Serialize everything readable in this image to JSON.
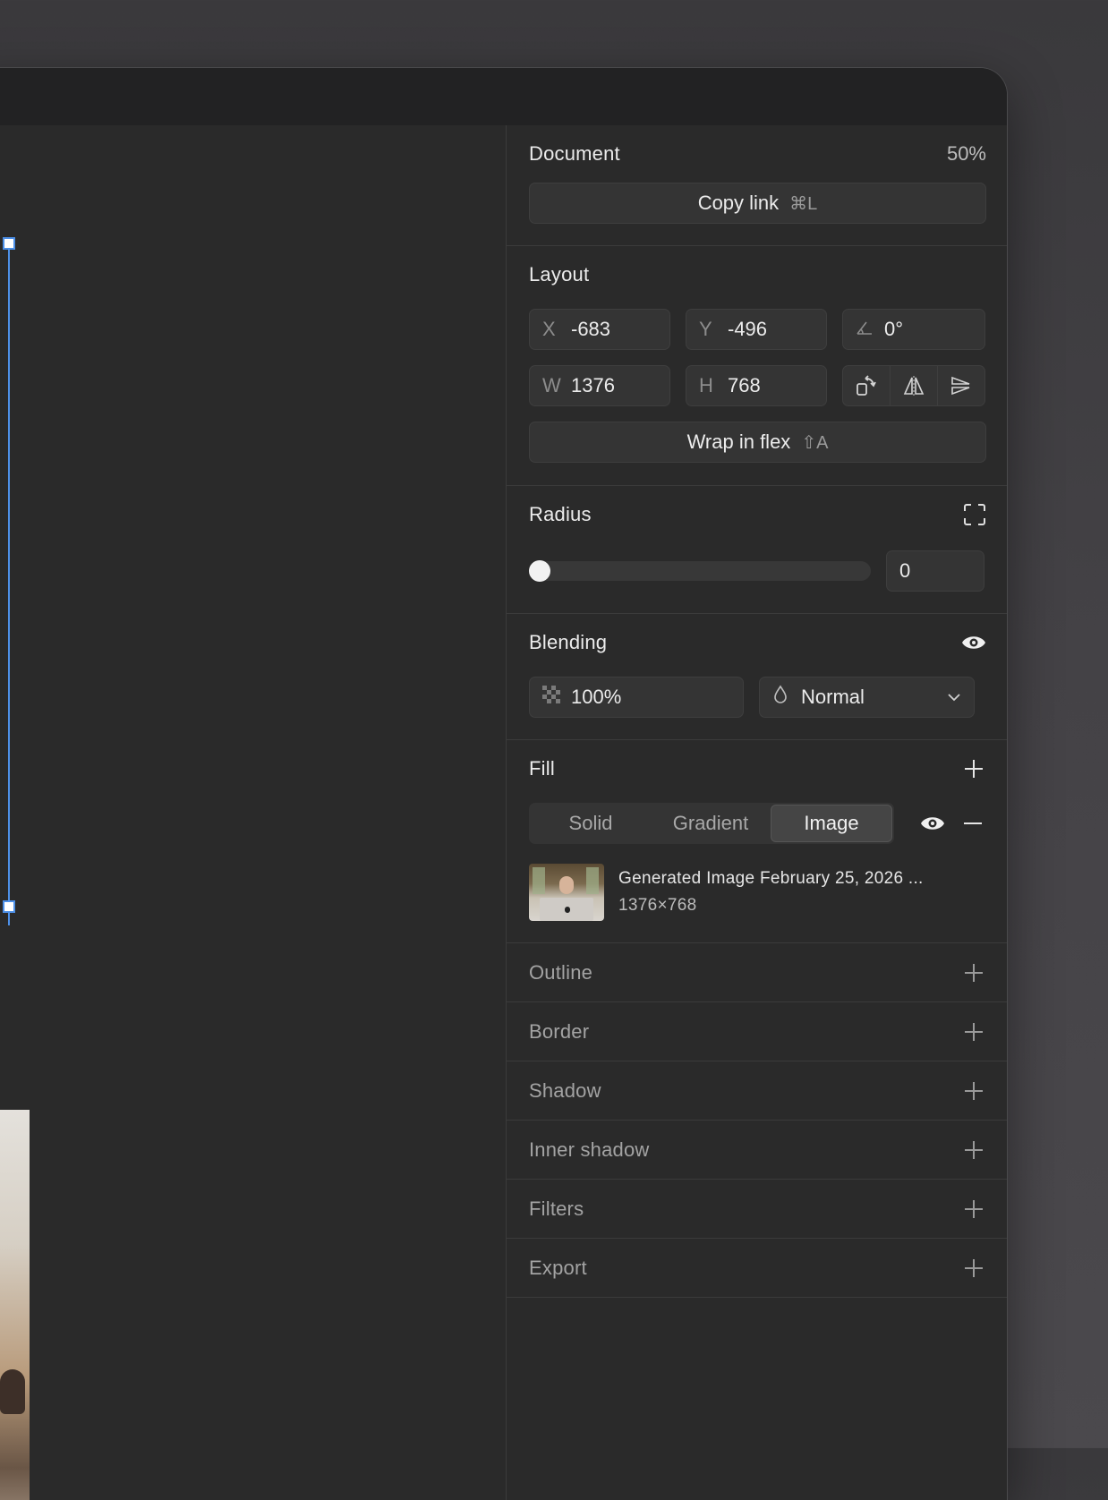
{
  "document": {
    "title": "Document",
    "zoom": "50%",
    "copy_link_label": "Copy link",
    "copy_link_shortcut": "⌘L"
  },
  "layout": {
    "title": "Layout",
    "x_label": "X",
    "x_value": "-683",
    "y_label": "Y",
    "y_value": "-496",
    "rotation_value": "0°",
    "w_label": "W",
    "w_value": "1376",
    "h_label": "H",
    "h_value": "768",
    "wrap_label": "Wrap in flex",
    "wrap_shortcut": "⇧A"
  },
  "radius": {
    "title": "Radius",
    "value": "0",
    "slider_fraction": 0
  },
  "blending": {
    "title": "Blending",
    "opacity": "100%",
    "mode": "Normal"
  },
  "fill": {
    "title": "Fill",
    "tabs": [
      "Solid",
      "Gradient",
      "Image"
    ],
    "active_tab": "Image",
    "file_name": "Generated Image February 25, 2026 ...",
    "file_dims": "1376×768"
  },
  "sections": [
    "Outline",
    "Border",
    "Shadow",
    "Inner shadow",
    "Filters",
    "Export"
  ]
}
